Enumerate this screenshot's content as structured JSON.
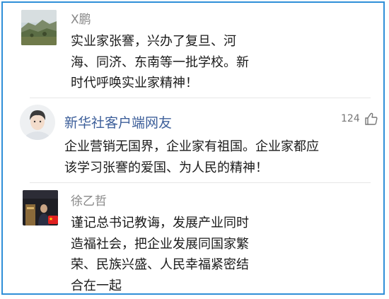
{
  "comments": [
    {
      "username": "X鹏",
      "lines": [
        "实业家张謇，兴办了复旦、河",
        "海、同济、东南等一批学校。新",
        "时代呼唤实业家精神！"
      ]
    },
    {
      "username": "新华社客户端网友",
      "likes": "124",
      "lines": [
        "企业营销无国界，企业家有祖国。企业家都应",
        "该学习张謇的爱国、为人民的精神！"
      ]
    },
    {
      "username": "徐乙哲",
      "lines": [
        "谨记总书记教诲，发展产业同时",
        "造福社会，把企业发展同国家繁",
        "荣、民族兴盛、人民幸福紧密结",
        "合在一起"
      ]
    }
  ],
  "icons": {
    "like": "thumbs-up-icon",
    "flag": "china-flag-icon"
  },
  "colors": {
    "frame_border": "#2f8fd8",
    "username_gray": "#888888",
    "username_blue": "#3d5f9a"
  }
}
